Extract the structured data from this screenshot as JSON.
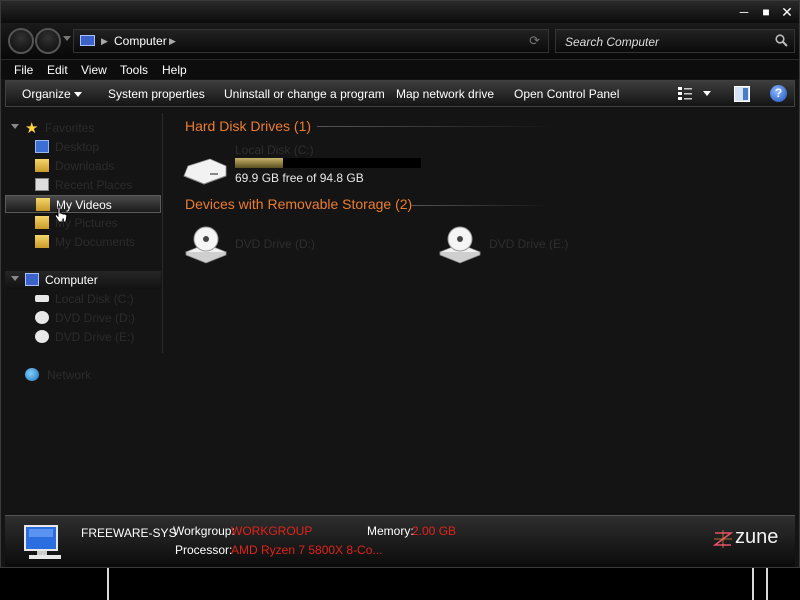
{
  "window": {
    "minimize_icon": "minimize-icon",
    "maximize_icon": "maximize-icon",
    "close_icon": "close-icon"
  },
  "nav": {
    "address": "Computer",
    "search_placeholder": "Search Computer"
  },
  "menu": [
    "File",
    "Edit",
    "View",
    "Tools",
    "Help"
  ],
  "toolbar": {
    "organize": "Organize",
    "system_properties": "System properties",
    "uninstall": "Uninstall or change a program",
    "map_drive": "Map network drive",
    "control_panel": "Open Control Panel",
    "help_glyph": "?"
  },
  "sidebar": {
    "favorites": "Favorites",
    "items": [
      "Desktop",
      "Downloads",
      "Recent Places",
      "My Videos",
      "My Pictures",
      "My Documents"
    ],
    "computer": "Computer",
    "computer_items": [
      "Local Disk (C:)",
      "DVD Drive (D:)",
      "DVD Drive (E:)"
    ],
    "network": "Network"
  },
  "content": {
    "hdd_header": "Hard Disk Drives (1)",
    "drive_c_label": "Local Disk (C:)",
    "drive_c_free": "69.9 GB free of 94.8 GB",
    "drive_c_used_fraction": 0.26,
    "removable_header": "Devices with Removable Storage (2)",
    "dvd_d_label": "DVD Drive (D:)",
    "dvd_e_label": "DVD Drive (E:)"
  },
  "details": {
    "name": "FREEWARE-SYS",
    "workgroup_label": "Workgroup:",
    "workgroup": "WORKGROUP",
    "memory_label": "Memory:",
    "memory": "2.00 GB",
    "processor_label": "Processor:",
    "processor": "AMD Ryzen 7 5800X 8-Co...",
    "brand": "zune"
  },
  "colors": {
    "accent": "#ec7d30",
    "value": "#e0231b",
    "background": "#141414"
  }
}
